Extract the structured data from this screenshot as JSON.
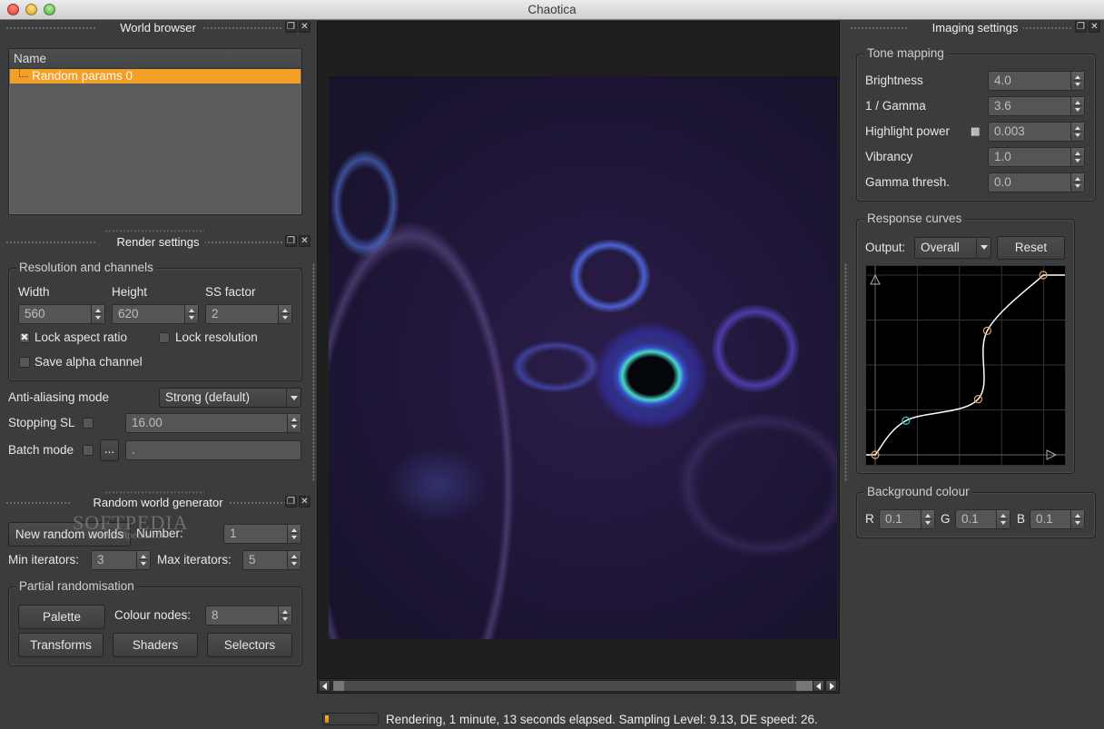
{
  "window": {
    "title": "Chaotica"
  },
  "world_browser": {
    "title": "World browser",
    "column_header": "Name",
    "items": [
      {
        "label": "Random params 0",
        "selected": true
      }
    ]
  },
  "render_settings": {
    "title": "Render settings",
    "resolution_group": "Resolution and channels",
    "width_label": "Width",
    "width_value": "560",
    "height_label": "Height",
    "height_value": "620",
    "ss_label": "SS factor",
    "ss_value": "2",
    "lock_aspect_label": "Lock aspect ratio",
    "lock_aspect_checked": true,
    "lock_resolution_label": "Lock resolution",
    "lock_resolution_checked": false,
    "save_alpha_label": "Save alpha channel",
    "save_alpha_checked": false,
    "aa_label": "Anti-aliasing mode",
    "aa_value": "Strong (default)",
    "stopping_label": "Stopping SL",
    "stopping_checked": false,
    "stopping_value": "16.00",
    "batch_label": "Batch mode",
    "batch_checked": false,
    "batch_browse": "...",
    "batch_path": "."
  },
  "random_world": {
    "title": "Random world generator",
    "new_button": "New random worlds",
    "number_label": "Number:",
    "number_value": "1",
    "min_label": "Min iterators:",
    "min_value": "3",
    "max_label": "Max iterators:",
    "max_value": "5",
    "partial_group": "Partial randomisation",
    "palette_button": "Palette",
    "colour_nodes_label": "Colour nodes:",
    "colour_nodes_value": "8",
    "transforms_button": "Transforms",
    "shaders_button": "Shaders",
    "selectors_button": "Selectors"
  },
  "watermark": {
    "brand": "SOFTPEDIA",
    "url": "www.softpedia.com"
  },
  "imaging_settings": {
    "title": "Imaging settings",
    "tone_group": "Tone mapping",
    "fields": [
      {
        "label": "Brightness",
        "value": "4.0"
      },
      {
        "label": "1 / Gamma",
        "value": "3.6"
      },
      {
        "label": "Highlight power",
        "value": "0.003",
        "checkbox": true
      },
      {
        "label": "Vibrancy",
        "value": "1.0"
      },
      {
        "label": "Gamma thresh.",
        "value": "0.0"
      }
    ],
    "curves_group": "Response curves",
    "output_label": "Output:",
    "output_value": "Overall",
    "reset_button": "Reset",
    "curve_points": [
      [
        0.0,
        0.0
      ],
      [
        0.17,
        0.19
      ],
      [
        0.57,
        0.31
      ],
      [
        0.62,
        0.69
      ],
      [
        0.93,
        1.0
      ]
    ],
    "active_point": 1,
    "colors": {
      "point": "#e8a060",
      "active_point": "#40c0d0",
      "curve": "#ffffff"
    },
    "bg_group": "Background colour",
    "r_label": "R",
    "r_value": "0.1",
    "g_label": "G",
    "g_value": "0.1",
    "b_label": "B",
    "b_value": "0.1"
  },
  "status": {
    "progress": 0.08,
    "text": "Rendering, 1 minute, 13 seconds elapsed. Sampling Level: 9.13, DE speed: 26."
  }
}
